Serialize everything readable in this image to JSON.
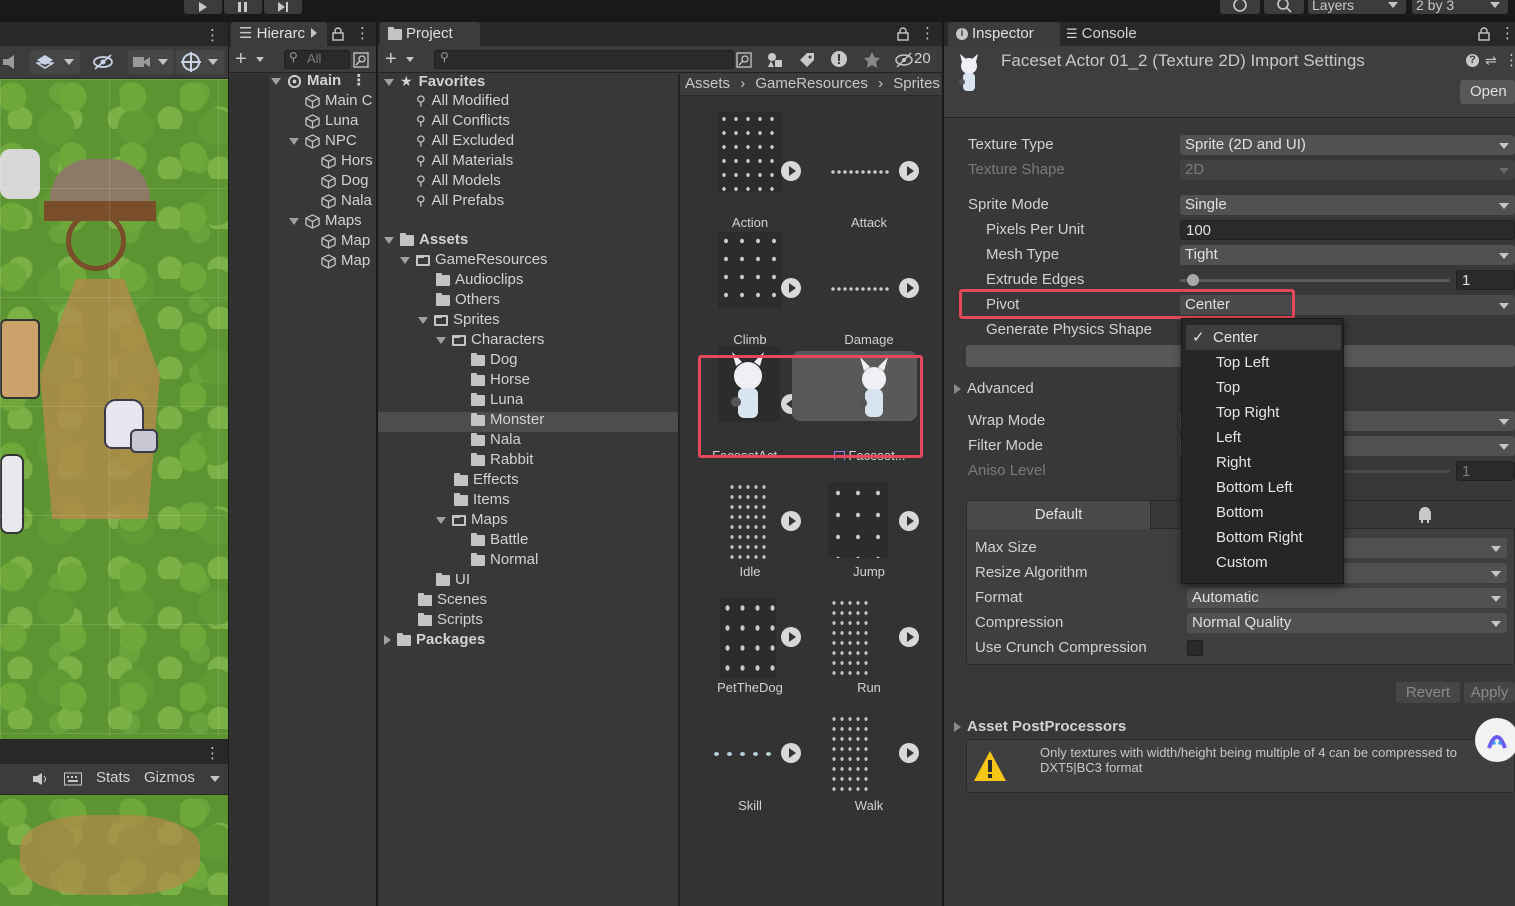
{
  "toolbar": {
    "layers_label": "Layers",
    "layout_label": "2 by 3"
  },
  "scene": {
    "stats_label": "Stats",
    "gizmos_label": "Gizmos"
  },
  "hierarchy": {
    "tab_label": "Hierarc",
    "search_placeholder": "All",
    "items": [
      {
        "label": "Main",
        "bold": true
      },
      {
        "label": "Main C"
      },
      {
        "label": "Luna"
      },
      {
        "label": "NPC"
      },
      {
        "label": "Hors"
      },
      {
        "label": "Dog"
      },
      {
        "label": "Nala"
      },
      {
        "label": "Maps"
      },
      {
        "label": "Map"
      },
      {
        "label": "Map"
      }
    ]
  },
  "project": {
    "tab_label": "Project",
    "hidden_count": "20",
    "breadcrumb": [
      "Assets",
      "GameResources",
      "Sprites"
    ],
    "tree": [
      {
        "label": "Favorites",
        "bold": true
      },
      {
        "label": "All Modified"
      },
      {
        "label": "All Conflicts"
      },
      {
        "label": "All Excluded"
      },
      {
        "label": "All Materials"
      },
      {
        "label": "All Models"
      },
      {
        "label": "All Prefabs"
      },
      {
        "label": "Assets",
        "bold": true
      },
      {
        "label": "GameResources"
      },
      {
        "label": "Audioclips"
      },
      {
        "label": "Others"
      },
      {
        "label": "Sprites"
      },
      {
        "label": "Characters"
      },
      {
        "label": "Dog"
      },
      {
        "label": "Horse"
      },
      {
        "label": "Luna"
      },
      {
        "label": "Monster"
      },
      {
        "label": "Nala"
      },
      {
        "label": "Rabbit"
      },
      {
        "label": "Effects"
      },
      {
        "label": "Items"
      },
      {
        "label": "Maps"
      },
      {
        "label": "Battle"
      },
      {
        "label": "Normal"
      },
      {
        "label": "UI"
      },
      {
        "label": "Scenes"
      },
      {
        "label": "Scripts"
      },
      {
        "label": "Packages",
        "bold": true
      }
    ],
    "assets": [
      {
        "label": "Action"
      },
      {
        "label": "Attack"
      },
      {
        "label": "Climb"
      },
      {
        "label": "Damage"
      },
      {
        "label": "FacesetAct..."
      },
      {
        "label": "Faceset..."
      },
      {
        "label": "Idle"
      },
      {
        "label": "Jump"
      },
      {
        "label": "PetTheDog"
      },
      {
        "label": "Run"
      },
      {
        "label": "Skill"
      },
      {
        "label": "Walk"
      }
    ]
  },
  "inspector": {
    "tab_label": "Inspector",
    "console_tab_label": "Console",
    "title": "Faceset Actor 01_2 (Texture 2D) Import Settings",
    "open_label": "Open",
    "fields": {
      "texture_type_label": "Texture Type",
      "texture_type_value": "Sprite (2D and UI)",
      "texture_shape_label": "Texture Shape",
      "texture_shape_value": "2D",
      "sprite_mode_label": "Sprite Mode",
      "sprite_mode_value": "Single",
      "ppu_label": "Pixels Per Unit",
      "ppu_value": "100",
      "mesh_type_label": "Mesh Type",
      "mesh_type_value": "Tight",
      "extrude_label": "Extrude Edges",
      "extrude_value": "1",
      "pivot_label": "Pivot",
      "pivot_value": "Center",
      "physics_label": "Generate Physics Shape",
      "advanced_label": "Advanced",
      "wrap_label": "Wrap Mode",
      "filter_label": "Filter Mode",
      "aniso_label": "Aniso Level",
      "aniso_value": "1"
    },
    "platform": {
      "default_tab": "Default",
      "max_size_label": "Max Size",
      "resize_label": "Resize Algorithm",
      "format_label": "Format",
      "format_value": "Automatic",
      "compression_label": "Compression",
      "compression_value": "Normal Quality",
      "crunch_label": "Use Crunch Compression"
    },
    "revert_label": "Revert",
    "apply_label": "Apply",
    "postprocessors_label": "Asset PostProcessors",
    "warning_text": "Only textures with width/height being multiple of 4 can be compressed to DXT5|BC3 format"
  },
  "pivot_dropdown": {
    "options": [
      "Center",
      "Top Left",
      "Top",
      "Top Right",
      "Left",
      "Right",
      "Bottom Left",
      "Bottom",
      "Bottom Right",
      "Custom"
    ],
    "selected": "Center",
    "checkmark": "✓"
  },
  "colors": {
    "highlight_box": "#e5485a",
    "panel_bg": "#383838",
    "selected_row": "#4d4d4d"
  }
}
